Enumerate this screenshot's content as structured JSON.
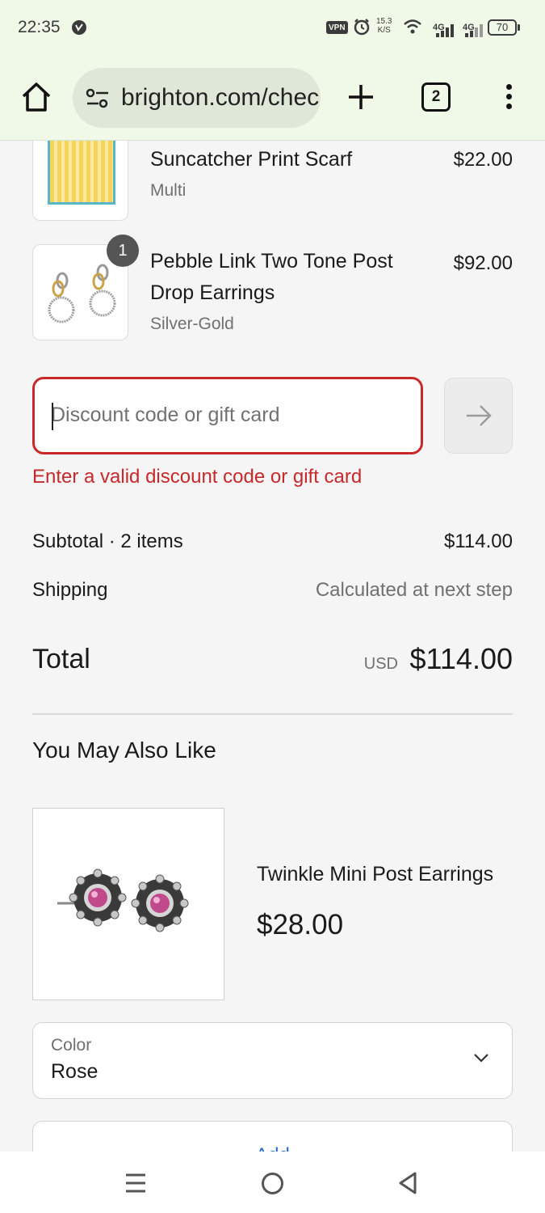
{
  "status": {
    "time": "22:35",
    "vpn": "VPN",
    "speed_value": "15.3",
    "speed_unit": "K/S",
    "net1": "4G",
    "net2": "4G",
    "battery": "70"
  },
  "browser": {
    "url": "brighton.com/checkouts",
    "tab_count": "2"
  },
  "cart": {
    "items": [
      {
        "name": "Suncatcher Print Scarf",
        "variant": "Multi",
        "price": "$22.00"
      },
      {
        "name": "Pebble Link Two Tone Post Drop Earrings",
        "variant": "Silver-Gold",
        "price": "$92.00",
        "quantity": "1"
      }
    ]
  },
  "discount": {
    "placeholder": "Discount code or gift card",
    "error": "Enter a valid discount code or gift card"
  },
  "summary": {
    "subtotal_label": "Subtotal · 2 items",
    "subtotal_value": "$114.00",
    "shipping_label": "Shipping",
    "shipping_value": "Calculated at next step",
    "total_label": "Total",
    "currency": "USD",
    "total_value": "$114.00"
  },
  "recommendations": {
    "heading": "You May Also Like",
    "product": {
      "name": "Twinkle Mini Post Earrings",
      "price": "$28.00",
      "color_label": "Color",
      "color_value": "Rose",
      "add_label": "Add"
    }
  }
}
